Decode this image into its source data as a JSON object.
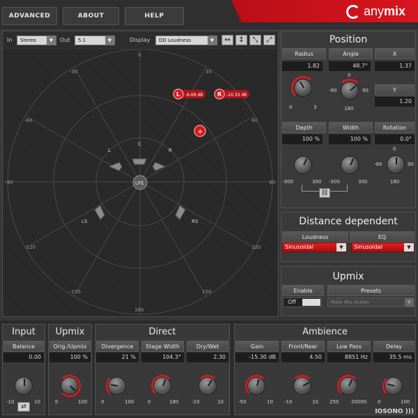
{
  "nav": {
    "advanced": "ADVANCED",
    "about": "ABOUT",
    "help": "HELP"
  },
  "logo": {
    "text_a": "any",
    "text_b": "mix"
  },
  "toolbar": {
    "in_label": "In",
    "in_value": "Stereo",
    "out_label": "Out",
    "out_value": "5.1",
    "display_label": "Display",
    "display_value": "DD Loudness"
  },
  "stage": {
    "angle_labels": {
      "top": "0",
      "bottom": "180",
      "left": "-90",
      "right": "90",
      "ul30": "-30",
      "ur30": "30",
      "ul60": "-60",
      "ur60": "60",
      "ll120": "-120",
      "lr120": "120",
      "ll150": "-150",
      "lr150": "150"
    },
    "speakers": {
      "l": "L",
      "c": "C",
      "r": "R",
      "ls": "LS",
      "rs": "RS",
      "lfe": "LFE"
    },
    "sources": [
      {
        "label": "L",
        "value": "-6.69 dB"
      },
      {
        "label": "R",
        "value": "-10.33 dB"
      }
    ],
    "add_source": "+"
  },
  "position": {
    "title": "Position",
    "radius_label": "Radius",
    "radius_value": "1.82",
    "radius_min": "0",
    "radius_max": "3",
    "angle_label": "Angle",
    "angle_value": "48.7°",
    "angle_top": "0",
    "angle_left": "-90",
    "angle_right": "90",
    "angle_bottom": "180",
    "x_label": "X",
    "x_value": "1.37",
    "y_label": "Y",
    "y_value": "1.20",
    "depth_label": "Depth",
    "depth_value": "100 %",
    "depth_min": "-300",
    "depth_max": "300",
    "width_label": "Width",
    "width_value": "100 %",
    "width_min": "-300",
    "width_max": "300",
    "rotation_label": "Rotation",
    "rotation_value": "0.0°",
    "rotation_top": "0",
    "rotation_left": "-90",
    "rotation_right": "90",
    "rotation_bottom": "180"
  },
  "distance": {
    "title": "Distance dependent",
    "loudness_label": "Loudness",
    "loudness_value": "Sinusoidal",
    "eq_label": "EQ",
    "eq_value": "Sinusoidal"
  },
  "upmix_panel": {
    "title": "Upmix",
    "enable_label": "Enable",
    "enable_value": "Off",
    "presets_label": "Presets",
    "presets_value": "Main Mix Action"
  },
  "bottom": {
    "input": {
      "title": "Input",
      "balance_label": "Balance",
      "balance_value": "0.00",
      "min": "-10",
      "max": "10"
    },
    "upmix": {
      "title": "Upmix",
      "label": "Orig./Upmix",
      "value": "100 %",
      "min": "0",
      "max": "100"
    },
    "direct": {
      "title": "Direct",
      "divergence_label": "Divergence",
      "divergence_value": "21 %",
      "divergence_min": "0",
      "divergence_max": "100",
      "stage_label": "Stage Width",
      "stage_value": "104.3°",
      "stage_min": "0",
      "stage_max": "180",
      "drywet_label": "Dry/Wet",
      "drywet_value": "2.30",
      "drywet_min": "-10",
      "drywet_max": "10"
    },
    "ambience": {
      "title": "Ambience",
      "gain_label": "Gain",
      "gain_value": "-15.30 dB",
      "gain_min": "-50",
      "gain_max": "10",
      "fr_label": "Front/Rear",
      "fr_value": "4.50",
      "fr_min": "-10",
      "fr_max": "10",
      "lp_label": "Low Pass",
      "lp_value": "8851 Hz",
      "lp_min": "250",
      "lp_max": "20000",
      "delay_label": "Delay",
      "delay_value": "35.5 ms",
      "delay_min": "0",
      "delay_max": "100"
    },
    "brand": "IOSONO )))"
  }
}
